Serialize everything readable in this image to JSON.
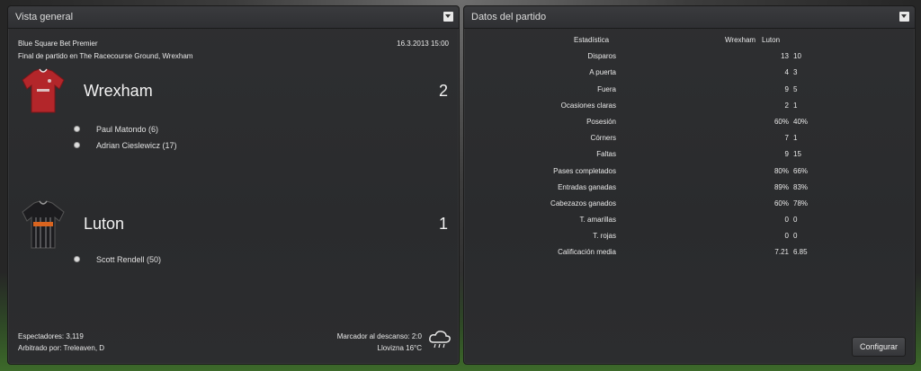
{
  "overview": {
    "title": "Vista general",
    "competition": "Blue Square Bet Premier",
    "datetime": "16.3.2013 15:00",
    "venue": "Final de partido en The Racecourse Ground, Wrexham",
    "home": {
      "name": "Wrexham",
      "score": "2",
      "kit_color": "#b3262a",
      "scorers": [
        "Paul Matondo (6)",
        "Adrian Cieslewicz (17)"
      ]
    },
    "away": {
      "name": "Luton",
      "score": "1",
      "kit_color": "#1c1c1f",
      "scorers": [
        "Scott Rendell (50)"
      ]
    },
    "attendance": "Espectadores: 3,119",
    "referee": "Arbitrado por: Treleaven, D",
    "halftime": "Marcador al descanso: 2:0",
    "weather": "Llovizna 16°C",
    "weather_icon": "rain-cloud-icon"
  },
  "stats": {
    "title": "Datos del partido",
    "header": {
      "label": "Estadística",
      "home": "Wrexham",
      "away": "Luton"
    },
    "rows": [
      {
        "label": "Disparos",
        "home": "13",
        "away": "10"
      },
      {
        "label": "A puerta",
        "home": "4",
        "away": "3"
      },
      {
        "label": "Fuera",
        "home": "9",
        "away": "5"
      },
      {
        "label": "Ocasiones claras",
        "home": "2",
        "away": "1"
      },
      {
        "label": "Posesión",
        "home": "60%",
        "away": "40%"
      },
      {
        "label": "Córners",
        "home": "7",
        "away": "1"
      },
      {
        "label": "Faltas",
        "home": "9",
        "away": "15"
      },
      {
        "label": "Pases completados",
        "home": "80%",
        "away": "66%"
      },
      {
        "label": "Entradas ganadas",
        "home": "89%",
        "away": "83%"
      },
      {
        "label": "Cabezazos ganados",
        "home": "60%",
        "away": "78%"
      },
      {
        "label": "T. amarillas",
        "home": "0",
        "away": "0"
      },
      {
        "label": "T. rojas",
        "home": "0",
        "away": "0"
      },
      {
        "label": "Calificación media",
        "home": "7.21",
        "away": "6.85"
      }
    ],
    "configure_label": "Configurar"
  }
}
